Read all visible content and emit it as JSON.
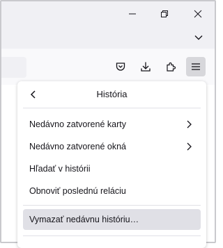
{
  "window": {
    "controls": [
      "minimize-icon",
      "restore-icon",
      "close-icon"
    ]
  },
  "tabbar": {
    "list_tabs_icon": "chevron-down-icon"
  },
  "toolbar": {
    "icons": [
      "pocket-icon",
      "download-icon",
      "extensions-icon",
      "menu-icon"
    ]
  },
  "panel": {
    "title": "História",
    "back_icon": "back-arrow-icon",
    "items": [
      {
        "label": "Nedávno zatvorené karty",
        "submenu": true
      },
      {
        "label": "Nedávno zatvorené okná",
        "submenu": true
      },
      {
        "label": "Hľadať v histórii",
        "submenu": false
      },
      {
        "label": "Obnoviť poslednú reláciu",
        "submenu": false
      }
    ],
    "clear_history_label": "Vymazať nedávnu históriu…"
  },
  "colors": {
    "chrome": "#f0f0f4",
    "toolbar": "#f9f9fb",
    "hover": "#e0e0e6",
    "text": "#15141a"
  }
}
